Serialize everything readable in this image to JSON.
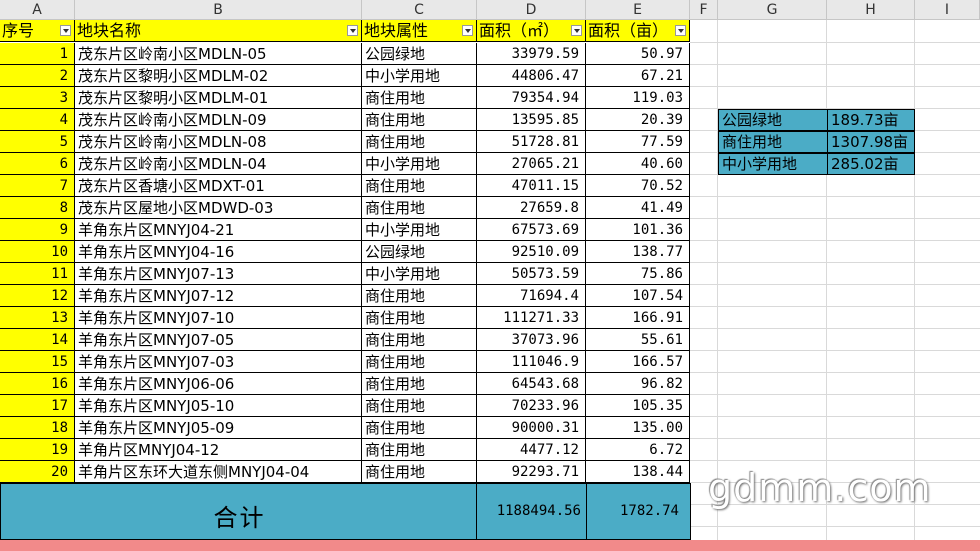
{
  "column_headers": [
    "A",
    "B",
    "C",
    "D",
    "E",
    "F",
    "G",
    "H",
    "I"
  ],
  "table_header": {
    "seq": "序号",
    "name": "地块名称",
    "attr": "地块属性",
    "area_m2": "面积（㎡）",
    "area_mu": "面积（亩）"
  },
  "rows": [
    {
      "seq": "1",
      "name": "茂东片区岭南小区MDLN-05",
      "attr": "公园绿地",
      "area_m2": "33979.59",
      "area_mu": "50.97"
    },
    {
      "seq": "2",
      "name": "茂东片区黎明小区MDLM-02",
      "attr": "中小学用地",
      "area_m2": "44806.47",
      "area_mu": "67.21"
    },
    {
      "seq": "3",
      "name": "茂东片区黎明小区MDLM-01",
      "attr": "商住用地",
      "area_m2": "79354.94",
      "area_mu": "119.03"
    },
    {
      "seq": "4",
      "name": "茂东片区岭南小区MDLN-09",
      "attr": "商住用地",
      "area_m2": "13595.85",
      "area_mu": "20.39"
    },
    {
      "seq": "5",
      "name": "茂东片区岭南小区MDLN-08",
      "attr": "商住用地",
      "area_m2": "51728.81",
      "area_mu": "77.59"
    },
    {
      "seq": "6",
      "name": "茂东片区岭南小区MDLN-04",
      "attr": "中小学用地",
      "area_m2": "27065.21",
      "area_mu": "40.60"
    },
    {
      "seq": "7",
      "name": "茂东片区香塘小区MDXT-01",
      "attr": "商住用地",
      "area_m2": "47011.15",
      "area_mu": "70.52"
    },
    {
      "seq": "8",
      "name": "茂东片区屋地小区MDWD-03",
      "attr": "商住用地",
      "area_m2": "27659.8",
      "area_mu": "41.49"
    },
    {
      "seq": "9",
      "name": "羊角东片区MNYJ04-21",
      "attr": "中小学用地",
      "area_m2": "67573.69",
      "area_mu": "101.36"
    },
    {
      "seq": "10",
      "name": "羊角东片区MNYJ04-16",
      "attr": "公园绿地",
      "area_m2": "92510.09",
      "area_mu": "138.77"
    },
    {
      "seq": "11",
      "name": "羊角东片区MNYJ07-13",
      "attr": "中小学用地",
      "area_m2": "50573.59",
      "area_mu": "75.86"
    },
    {
      "seq": "12",
      "name": "羊角东片区MNYJ07-12",
      "attr": "商住用地",
      "area_m2": "71694.4",
      "area_mu": "107.54"
    },
    {
      "seq": "13",
      "name": "羊角东片区MNYJ07-10",
      "attr": "商住用地",
      "area_m2": "111271.33",
      "area_mu": "166.91"
    },
    {
      "seq": "14",
      "name": "羊角东片区MNYJ07-05",
      "attr": "商住用地",
      "area_m2": "37073.96",
      "area_mu": "55.61"
    },
    {
      "seq": "15",
      "name": "羊角东片区MNYJ07-03",
      "attr": "商住用地",
      "area_m2": "111046.9",
      "area_mu": "166.57"
    },
    {
      "seq": "16",
      "name": "羊角东片区MNYJ06-06",
      "attr": "商住用地",
      "area_m2": "64543.68",
      "area_mu": "96.82"
    },
    {
      "seq": "17",
      "name": "羊角东片区MNYJ05-10",
      "attr": "商住用地",
      "area_m2": "70233.96",
      "area_mu": "105.35"
    },
    {
      "seq": "18",
      "name": "羊角东片区MNYJ05-09",
      "attr": "商住用地",
      "area_m2": "90000.31",
      "area_mu": "135.00"
    },
    {
      "seq": "19",
      "name": "羊角片区MNYJ04-12",
      "attr": "商住用地",
      "area_m2": "4477.12",
      "area_mu": "6.72"
    },
    {
      "seq": "20",
      "name": "羊角片区东环大道东侧MNYJ04-04",
      "attr": "商住用地",
      "area_m2": "92293.71",
      "area_mu": "138.44"
    }
  ],
  "total": {
    "label": "合计",
    "area_m2": "1188494.56",
    "area_mu": "1782.74"
  },
  "summary": [
    {
      "attr": "公园绿地",
      "value": "189.73亩"
    },
    {
      "attr": "商住用地",
      "value": "1307.98亩"
    },
    {
      "attr": "中小学用地",
      "value": "285.02亩"
    }
  ],
  "watermark": "gdmm.com",
  "colors": {
    "header_fill": "#ffff00",
    "total_fill": "#4bacc6",
    "bottom_bar": "#f28a8a"
  }
}
